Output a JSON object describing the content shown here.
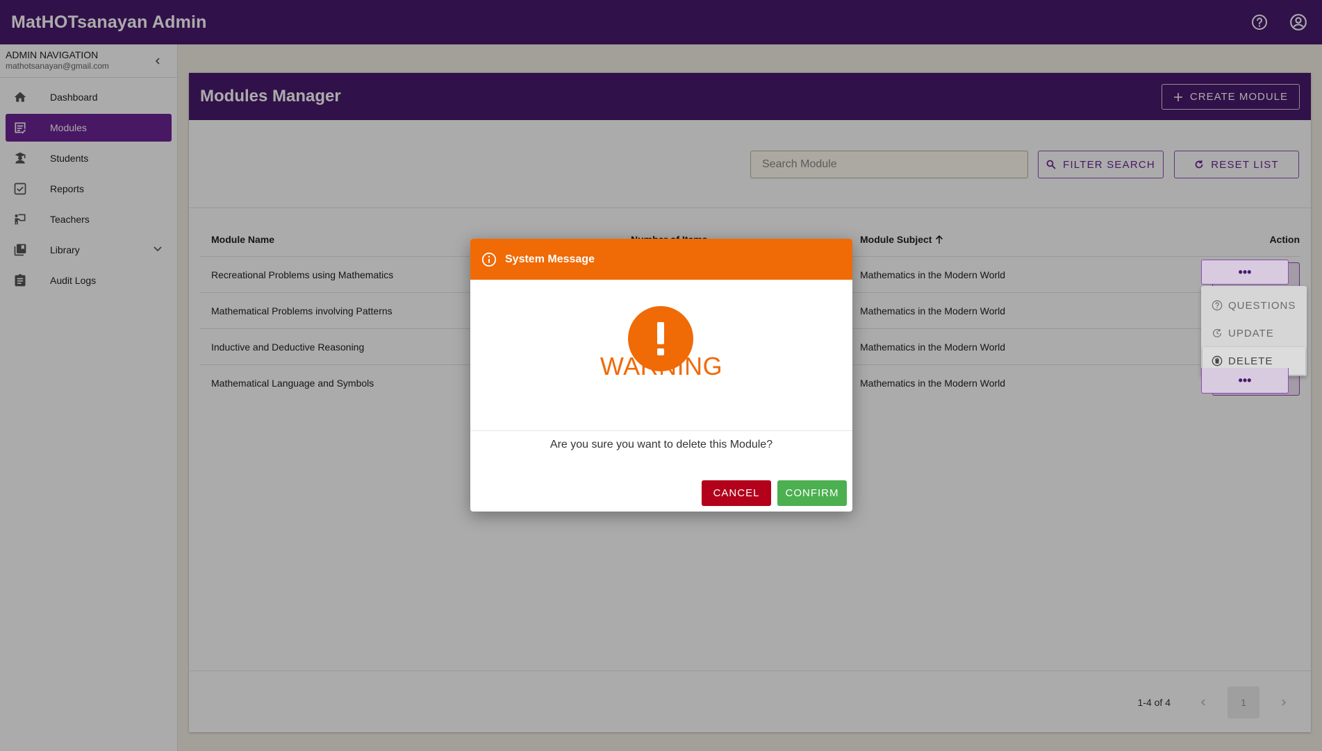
{
  "app": {
    "title": "MatHOTsanayan Admin"
  },
  "topbar": {
    "help_icon": "help-circle-icon",
    "account_icon": "account-circle-icon"
  },
  "sidebar": {
    "title": "ADMIN NAVIGATION",
    "email": "mathotsanayan@gmail.com",
    "items": [
      {
        "label": "Dashboard",
        "icon": "home-icon"
      },
      {
        "label": "Modules",
        "icon": "modules-icon",
        "active": true
      },
      {
        "label": "Students",
        "icon": "student-icon"
      },
      {
        "label": "Reports",
        "icon": "reports-icon"
      },
      {
        "label": "Teachers",
        "icon": "teacher-icon"
      },
      {
        "label": "Library",
        "icon": "library-icon"
      },
      {
        "label": "Audit Logs",
        "icon": "audit-icon"
      }
    ]
  },
  "page": {
    "title": "Modules Manager",
    "create_label": "CREATE MODULE",
    "search_placeholder": "Search Module",
    "filter_label": "FILTER SEARCH",
    "reset_label": "RESET LIST"
  },
  "table": {
    "headers": [
      "Module Name",
      "Number of Items",
      "Module Subject",
      "Action"
    ],
    "rows": [
      {
        "name": "Recreational Problems using Mathematics",
        "items": "",
        "subject": "Mathematics in the Modern World"
      },
      {
        "name": "Mathematical Problems involving Patterns",
        "items": "",
        "subject": "Mathematics in the Modern World"
      },
      {
        "name": "Inductive and Deductive Reasoning",
        "items": "",
        "subject": "Mathematics in the Modern World"
      },
      {
        "name": "Mathematical Language and Symbols",
        "items": "",
        "subject": "Mathematics in the Modern World"
      }
    ],
    "action_glyph": "•••"
  },
  "pagination": {
    "info": "1-4 of 4",
    "page": "1"
  },
  "action_menu": {
    "items": [
      "QUESTIONS",
      "UPDATE",
      "DELETE"
    ],
    "selected": "DELETE"
  },
  "dialog": {
    "header": "System Message",
    "heading": "WARNING",
    "message": "Are you sure you want to delete this Module?",
    "cancel_label": "CANCEL",
    "confirm_label": "CONFIRM",
    "accent_color": "#f06a06"
  },
  "colors": {
    "primary": "#4a1a6e",
    "active_nav": "#6d2496",
    "cancel": "#b3001b",
    "confirm": "#4caf50"
  }
}
